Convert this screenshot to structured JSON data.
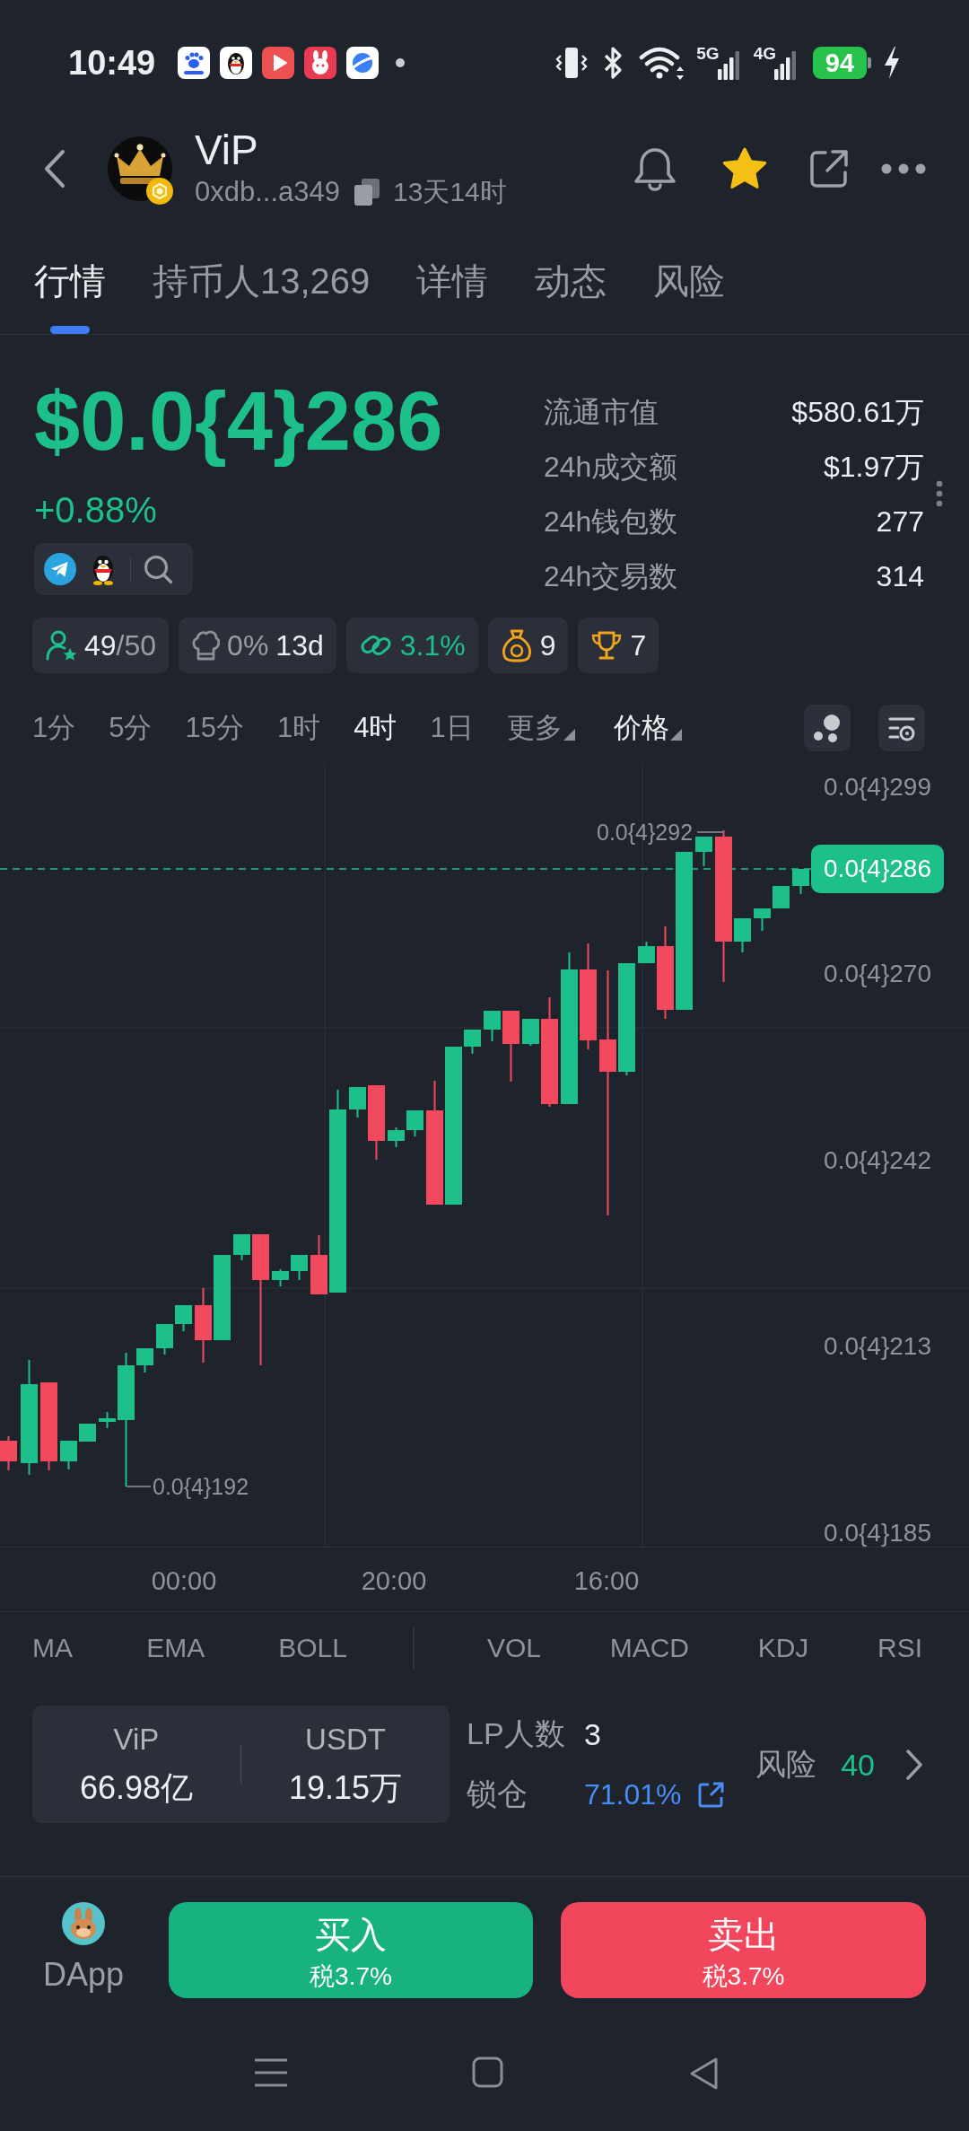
{
  "status_bar": {
    "time": "10:49",
    "networks": [
      {
        "type": "5G"
      },
      {
        "type": "4G"
      }
    ],
    "battery": "94",
    "charging": true
  },
  "header": {
    "title": "ViP",
    "address": "0xdb...a349",
    "age": "13天14时",
    "favorite": true
  },
  "tabs": [
    {
      "label": "行情",
      "selected": true
    },
    {
      "label": "持币人13,269",
      "selected": false
    },
    {
      "label": "详情",
      "selected": false
    },
    {
      "label": "动态",
      "selected": false
    },
    {
      "label": "风险",
      "selected": false
    }
  ],
  "price": {
    "value": "$0.0{4}286",
    "change": "+0.88%"
  },
  "stats": [
    {
      "label": "流通市值",
      "value": "$580.61万"
    },
    {
      "label": "24h成交额",
      "value": "$1.97万"
    },
    {
      "label": "24h钱包数",
      "value": "277"
    },
    {
      "label": "24h交易数",
      "value": "314"
    }
  ],
  "chips": [
    {
      "kind": "holders",
      "value": "49",
      "limit": "/50"
    },
    {
      "kind": "creator",
      "share": "0%",
      "age": "13d"
    },
    {
      "kind": "links",
      "value": "3.1%"
    },
    {
      "kind": "bag",
      "value": "9"
    },
    {
      "kind": "trophy",
      "value": "7"
    }
  ],
  "timeframes": [
    {
      "label": "1分",
      "selected": false,
      "kind": "interval"
    },
    {
      "label": "5分",
      "selected": false,
      "kind": "interval"
    },
    {
      "label": "15分",
      "selected": false,
      "kind": "interval"
    },
    {
      "label": "1时",
      "selected": false,
      "kind": "interval"
    },
    {
      "label": "4时",
      "selected": true,
      "kind": "interval"
    },
    {
      "label": "1日",
      "selected": false,
      "kind": "interval"
    },
    {
      "label": "更多",
      "selected": false,
      "kind": "menu"
    }
  ],
  "chart_mode": {
    "label": "价格"
  },
  "chart": {
    "y_labels": [
      "0.0{4}299",
      "0.0{4}270",
      "0.0{4}242",
      "0.0{4}213",
      "0.0{4}185"
    ],
    "current_price": "0.0{4}286",
    "high": "0.0{4}292",
    "low": "0.0{4}192",
    "x_labels": [
      "00:00",
      "20:00",
      "16:00"
    ]
  },
  "indicators": {
    "main": [
      "MA",
      "EMA",
      "BOLL"
    ],
    "sub": [
      "VOL",
      "MACD",
      "KDJ",
      "RSI"
    ]
  },
  "liquidity": {
    "pool": [
      {
        "symbol": "ViP",
        "amount": "66.98亿"
      },
      {
        "symbol": "USDT",
        "amount": "19.15万"
      }
    ],
    "lp_label": "LP人数",
    "lp_count": "3",
    "lock_label": "锁仓",
    "lock_value": "71.01%",
    "risk_label": "风险",
    "risk_score": "40"
  },
  "trade": {
    "dapp": "DApp",
    "buy": {
      "label": "买入",
      "tax": "税3.7%"
    },
    "sell": {
      "label": "卖出",
      "tax": "税3.7%"
    }
  }
}
